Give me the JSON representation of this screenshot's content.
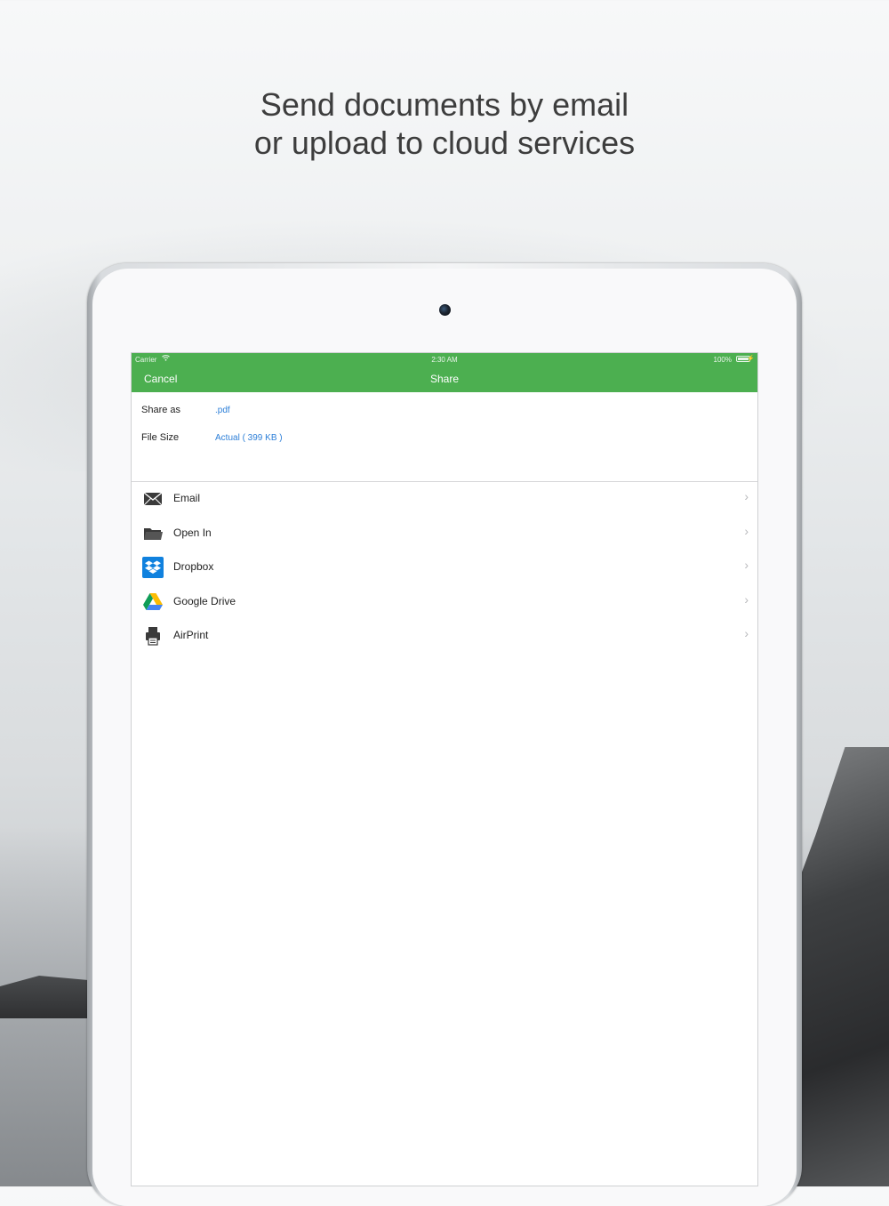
{
  "headline": {
    "line1": "Send documents by email",
    "line2": "or upload to cloud services"
  },
  "status_bar": {
    "carrier": "Carrier",
    "time": "2:30 AM",
    "battery_percent": "100%"
  },
  "navbar": {
    "cancel_label": "Cancel",
    "title": "Share",
    "color": "#4caf50"
  },
  "info": {
    "share_as_label": "Share as",
    "share_as_value": ".pdf",
    "file_size_label": "File Size",
    "file_size_value": "Actual ( 399 KB )"
  },
  "share_options": [
    {
      "label": "Email",
      "icon": "envelope-icon"
    },
    {
      "label": "Open In",
      "icon": "folder-icon"
    },
    {
      "label": "Dropbox",
      "icon": "dropbox-icon"
    },
    {
      "label": "Google Drive",
      "icon": "google-drive-icon"
    },
    {
      "label": "AirPrint",
      "icon": "printer-icon"
    }
  ],
  "colors": {
    "accent_green": "#4caf50",
    "link_blue": "#2d7fd8",
    "dropbox_blue": "#1081de"
  }
}
